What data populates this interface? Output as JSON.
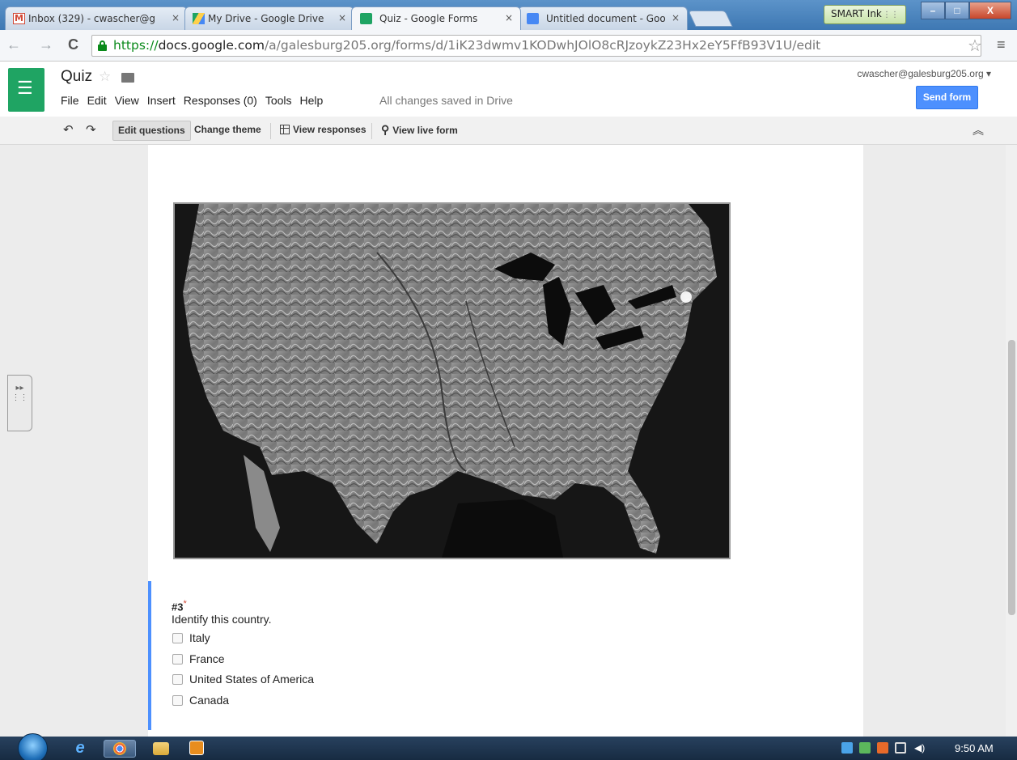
{
  "browser": {
    "tabs": [
      {
        "label": "Inbox (329) - cwascher@g"
      },
      {
        "label": "My Drive - Google Drive"
      },
      {
        "label": "Quiz - Google Forms"
      },
      {
        "label": "Untitled document - Goo"
      }
    ],
    "close_glyph": "×",
    "smart_ink_label": "SMART Ink",
    "url_https": "https://",
    "url_host": "docs.google.com",
    "url_path": "/a/galesburg205.org/forms/d/1iK23dwmv1KODwhJOlO8cRJzoykZ23Hx2eY5FfB93V1U/edit"
  },
  "doc": {
    "title": "Quiz",
    "menu": [
      "File",
      "Edit",
      "View",
      "Insert",
      "Responses (0)",
      "Tools",
      "Help"
    ],
    "save_status": "All changes saved in Drive",
    "account": "cwascher@galesburg205.org",
    "send_label": "Send form"
  },
  "toolbar": {
    "edit_questions": "Edit questions",
    "change_theme": "Change theme",
    "view_responses": "View responses",
    "view_live_form": "View live form"
  },
  "question": {
    "number": "#3",
    "required_mark": "*",
    "prompt": "Identify this country.",
    "options": [
      "Italy",
      "France",
      "United States of America",
      "Canada"
    ]
  },
  "taskbar": {
    "time": "9:50 AM"
  },
  "colors": {
    "forms_green": "#1fa463",
    "send_blue": "#4d90fe",
    "question_accent": "#4d90fe"
  },
  "icons": [
    "gmail-icon",
    "drive-icon",
    "forms-icon",
    "docs-icon",
    "lock-icon",
    "star-icon",
    "folder-icon",
    "undo-icon",
    "redo-icon",
    "table-icon",
    "link-icon",
    "collapse-icon"
  ]
}
